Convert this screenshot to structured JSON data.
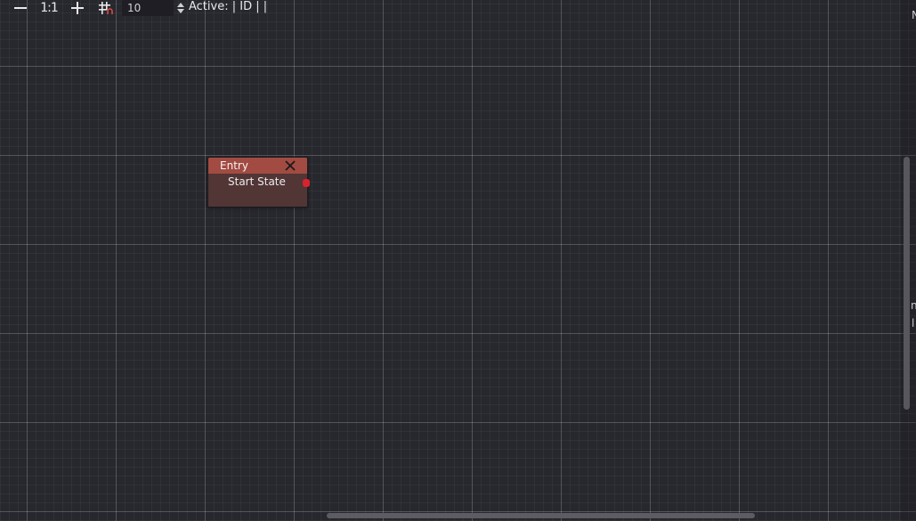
{
  "toolbar": {
    "zoom_out_icon": "minus-icon",
    "zoom_reset_label": "1:1",
    "zoom_in_icon": "plus-icon",
    "snap_icon": "grid-snap-icon",
    "snap_value": "10",
    "active_label": "Active: | ID | |"
  },
  "node": {
    "title": "Entry",
    "close_icon": "close-icon",
    "slot_label": "Start State",
    "header_color": "#a24b42",
    "body_color": "#523535",
    "port_color": "#d8232d"
  },
  "side_panel_clipped": {
    "top": "N",
    "mid": "n",
    "lower": "l"
  }
}
